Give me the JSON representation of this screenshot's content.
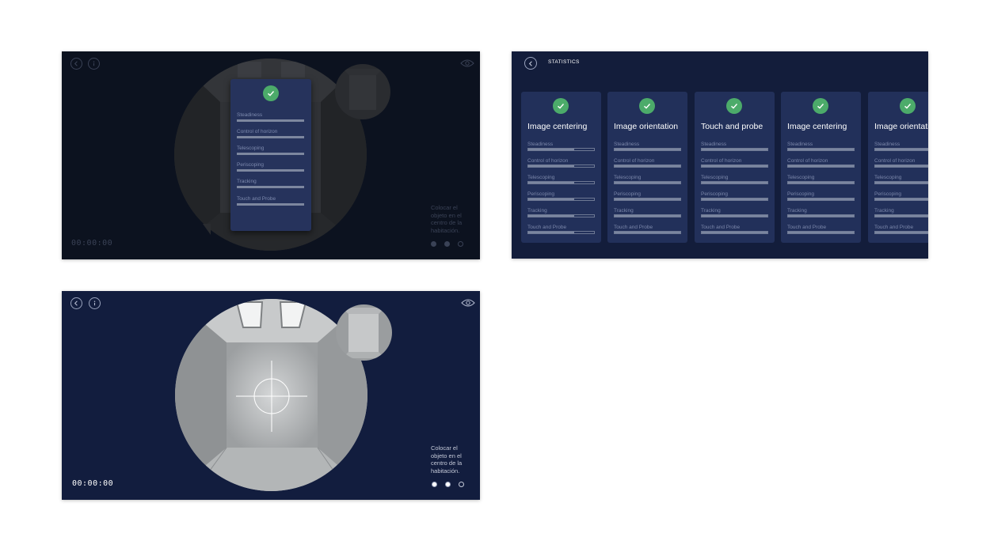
{
  "panel_1": {
    "timer": "00:00:00",
    "instruction": "Colocar el objeto en el centro de la habitación.",
    "metrics": [
      "Steadiness",
      "Control of horizon",
      "Telescoping",
      "Periscoping",
      "Tracking",
      "Touch and Probe"
    ]
  },
  "statistics": {
    "title": "STATISTICS",
    "metric_labels": [
      "Steadiness",
      "Control of horizon",
      "Telescoping",
      "Periscoping",
      "Tracking",
      "Touch and Probe"
    ],
    "cards": [
      {
        "title": "Image centering",
        "fills": [
          0.7,
          0.7,
          0.7,
          0.7,
          0.7,
          0.7
        ]
      },
      {
        "title": "Image orientation",
        "fills": [
          1,
          1,
          1,
          1,
          1,
          1
        ]
      },
      {
        "title": "Touch and probe",
        "fills": [
          1,
          1,
          1,
          1,
          1,
          1
        ]
      },
      {
        "title": "Image centering",
        "fills": [
          1,
          1,
          1,
          1,
          1,
          1
        ]
      },
      {
        "title": "Image orientation",
        "fills": [
          1,
          1,
          1,
          1,
          1,
          1
        ]
      }
    ]
  },
  "panel_3": {
    "timer": "00:00:00",
    "instruction": "Colocar el objeto en el centro de la habitación."
  },
  "icons": {
    "back": "chevron-left-icon",
    "info": "info-icon",
    "view": "eye-icon",
    "done": "checkmark-icon"
  },
  "colors": {
    "accent_green": "#4cab6a",
    "card_bg": "#22305a",
    "panel_bg": "#131d3b"
  },
  "progress_dots": {
    "total": 3,
    "filled": 2
  }
}
